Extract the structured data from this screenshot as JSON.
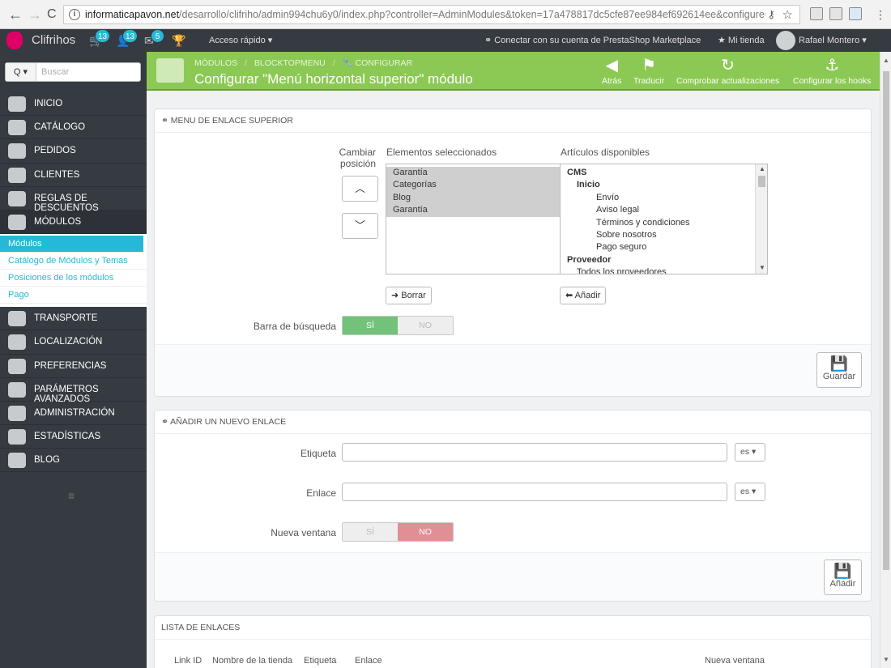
{
  "browser": {
    "back": "←",
    "forward": "→",
    "reload": "C",
    "url_host": "informaticapavon.net",
    "url_rest": "/desarrollo/clifriho/admin994chu6y0/index.php?controller=AdminModules&token=17a478817dc5cfe87ee984ef692614ee&configure=blc"
  },
  "topbar": {
    "brand": "Clifrihos",
    "orders_badge": "13",
    "customers_badge": "13",
    "messages_badge": "5",
    "quick_access": "Acceso rápido ▾",
    "marketplace": "Conectar con su cuenta de PrestaShop Marketplace",
    "my_shop": "Mi tienda",
    "user": "Rafael Montero ▾"
  },
  "sidebar": {
    "search_selector": "Q ▾",
    "search_placeholder": "Buscar",
    "items": [
      {
        "label": "Inicio",
        "icon": "home-icon"
      },
      {
        "label": "Catálogo",
        "icon": "book-icon"
      },
      {
        "label": "Pedidos",
        "icon": "credit-card-icon"
      },
      {
        "label": "Clientes",
        "icon": "users-icon"
      },
      {
        "label": "Reglas de descuentos",
        "icon": "tag-icon"
      },
      {
        "label": "Módulos",
        "icon": "puzzle-icon"
      },
      {
        "label": "Transporte",
        "icon": "truck-icon"
      },
      {
        "label": "Localización",
        "icon": "globe-icon"
      },
      {
        "label": "Preferencias",
        "icon": "wrench-icon"
      },
      {
        "label": "Parámetros avanzados",
        "icon": "cogs-icon"
      },
      {
        "label": "Administración",
        "icon": "cog-icon"
      },
      {
        "label": "Estadísticas",
        "icon": "bar-chart-icon"
      },
      {
        "label": "Blog",
        "icon": "pencil-icon"
      }
    ],
    "submenu": [
      "Módulos",
      "Catálogo de Módulos y Temas",
      "Posiciones de los módulos",
      "Pago"
    ],
    "collapse": "≡"
  },
  "header": {
    "breadcrumb_1": "Módulos",
    "breadcrumb_sep": "/",
    "breadcrumb_2": "blocktopmenu",
    "breadcrumb_3": "Configurar",
    "title": "Configurar \"Menú horizontal superior\" módulo",
    "toolbar": {
      "back": "Atrás",
      "translate": "Traducir",
      "check_updates": "Comprobar actualizaciones",
      "hooks": "Configurar los hooks"
    }
  },
  "panel1": {
    "heading": "Menu de enlace superior",
    "change_position_1": "Cambiar",
    "change_position_2": "posición",
    "selected_label": "Elementos seleccionados",
    "available_label": "Artículos disponibles",
    "selected_items": [
      "Garantía",
      "Categorías",
      "Blog",
      "Garantía"
    ],
    "available_items": [
      {
        "text": "CMS",
        "level": 0,
        "group": true
      },
      {
        "text": "Inicio",
        "level": 1,
        "group": true
      },
      {
        "text": "Envío",
        "level": 2,
        "group": false
      },
      {
        "text": "Aviso legal",
        "level": 2,
        "group": false
      },
      {
        "text": "Términos y condiciones",
        "level": 2,
        "group": false
      },
      {
        "text": "Sobre nosotros",
        "level": 2,
        "group": false
      },
      {
        "text": "Pago seguro",
        "level": 2,
        "group": false
      },
      {
        "text": "Proveedor",
        "level": 0,
        "group": true
      },
      {
        "text": "Todos los proveedores",
        "level": 1,
        "group": false
      }
    ],
    "remove_button": "Borrar",
    "add_button": "Añadir",
    "search_bar_label": "Barra de búsqueda",
    "search_bar_yes": "SÍ",
    "search_bar_no": "NO",
    "save": "Guardar"
  },
  "panel2": {
    "heading": "Añadir un nuevo enlace",
    "label_field": "Etiqueta",
    "link_field": "Enlace",
    "lang": "es",
    "new_window": "Nueva ventana",
    "yes": "SÍ",
    "no": "NO",
    "add": "Añadir"
  },
  "panel3": {
    "heading": "Lista de enlaces",
    "columns": [
      "Link ID",
      "Nombre de la tienda",
      "Etiqueta",
      "Enlace",
      "Nueva ventana"
    ]
  },
  "colors": {
    "header_green": "#8bc954",
    "sidebar": "#363a41",
    "accent": "#25b9d7"
  }
}
